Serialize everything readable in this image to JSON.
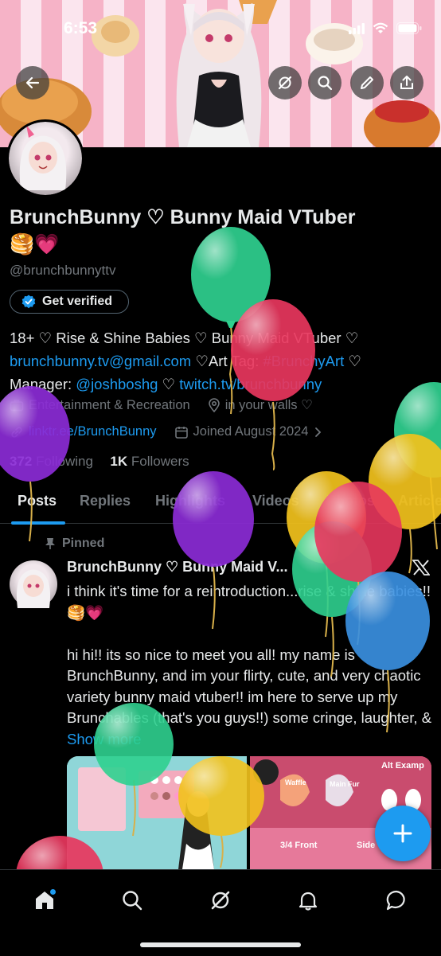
{
  "status_bar": {
    "time": "6:53"
  },
  "profile": {
    "display_name": "BrunchBunny ♡ Bunny Maid VTuber",
    "name_emoji": "🥞💗",
    "handle": "@brunchbunnyttv",
    "get_verified_label": "Get verified",
    "bio": {
      "line1": "18+ ♡ Rise & Shine Babies ♡ Bunny Maid VTuber ♡",
      "email": "brunchbunny.tv@gmail.com",
      "art_tag_prefix": " ♡Art Tag: ",
      "art_tag": "#BrunchyArt",
      "after_tag": " ♡",
      "manager_prefix": "Manager: ",
      "manager": "@joshboshg",
      "mid_sep": " ♡ ",
      "twitch": "twitch.tv/brunchbunny"
    },
    "category": "Entertainment & Recreation",
    "location": "in your walls ♡",
    "website": "linktr.ee/BrunchBunny",
    "joined": "Joined August 2024",
    "following_count": "372",
    "following_label": "Following",
    "followers_count": "1K",
    "followers_label": "Followers"
  },
  "tabs": [
    "Posts",
    "Replies",
    "Highlights",
    "Videos",
    "Photos",
    "Articles"
  ],
  "active_tab": "Posts",
  "pinned_post": {
    "pinned_label": "Pinned",
    "author": "BrunchBunny ♡ Bunny Maid V...",
    "intro": "i think it's time for a reintroduction...rise & shine babies!! 🥞💗",
    "body": "hi hi!! its so nice to meet you all! my name is BrunchBunny, and im your flirty, cute, and very chaotic variety bunny maid vtuber!! im here to serve up my Brunchables (that's you guys!!) some cringe, laughter, & ",
    "show_more": "Show more"
  },
  "media_text": {
    "alt_example": "Alt Examp",
    "waffle": "Waffle",
    "main_fur": "Main Fur",
    "front": "3/4 Front",
    "side": "Side"
  },
  "icons": {
    "back": "back-arrow-icon",
    "grok": "grok-icon",
    "search": "search-icon",
    "edit": "pencil-icon",
    "share": "share-icon",
    "verified": "verified-badge-icon",
    "category": "briefcase-icon",
    "location": "location-pin-icon",
    "link": "link-icon",
    "calendar": "calendar-icon",
    "pin": "pin-icon",
    "x_logo": "x-logo-icon",
    "compose": "plus-icon"
  },
  "colors": {
    "accent": "#1d9bf0",
    "background": "#000000",
    "text": "#e7e9ea",
    "muted": "#71767b",
    "balloon_green": "#2fd08f",
    "balloon_red": "#e8365d",
    "balloon_purple": "#8b2bd6",
    "balloon_yellow": "#f2c21c",
    "balloon_blue": "#3a8fe0"
  }
}
